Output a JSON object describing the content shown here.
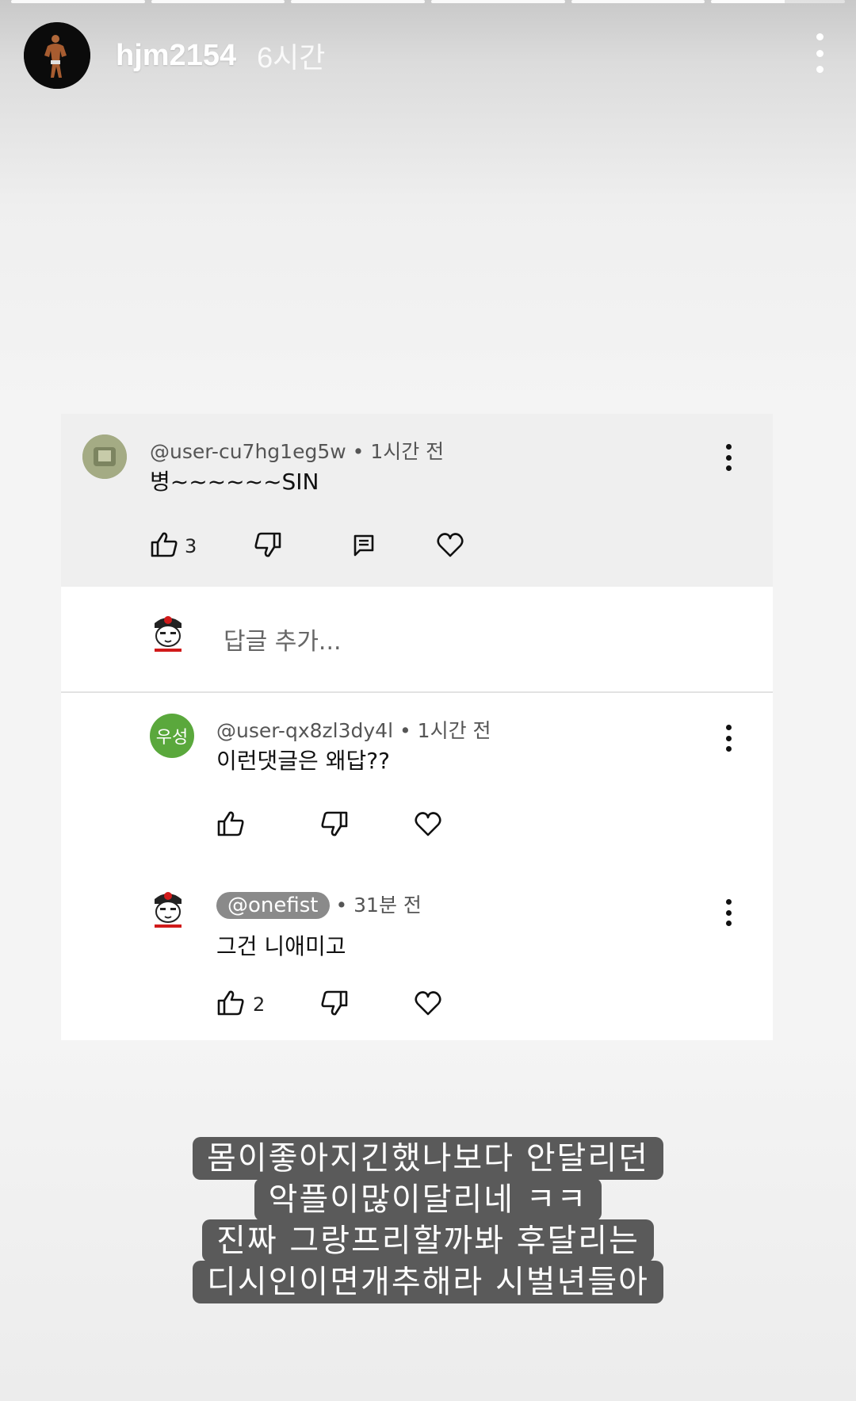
{
  "story": {
    "progress_segments": 6,
    "current_segment_fill": 0.55,
    "username": "hjm2154",
    "time": "6시간"
  },
  "comments": {
    "main": {
      "author": "@user-cu7hg1eg5w",
      "time": "• 1시간 전",
      "text": "병~~~~~~SIN",
      "likes": "3"
    },
    "reply_placeholder": "답글 추가...",
    "reply1": {
      "avatar_label": "우성",
      "author": "@user-qx8zl3dy4l",
      "time": "• 1시간 전",
      "text": "이런댓글은 왜답??"
    },
    "reply2": {
      "author": "@onefist",
      "time": "• 31분 전",
      "text": "그건 니애미고",
      "likes": "2"
    }
  },
  "caption": {
    "lines": [
      "몸이좋아지긴했나보다 안달리던",
      "악플이많이달리네 ㅋㅋ",
      "진짜 그랑프리할까봐 후달리는",
      "디시인이면개추해라 시벌년들아"
    ]
  },
  "colors": {
    "green_avatar": "#5aa83c",
    "caption_bg": "#5a5a5a"
  }
}
